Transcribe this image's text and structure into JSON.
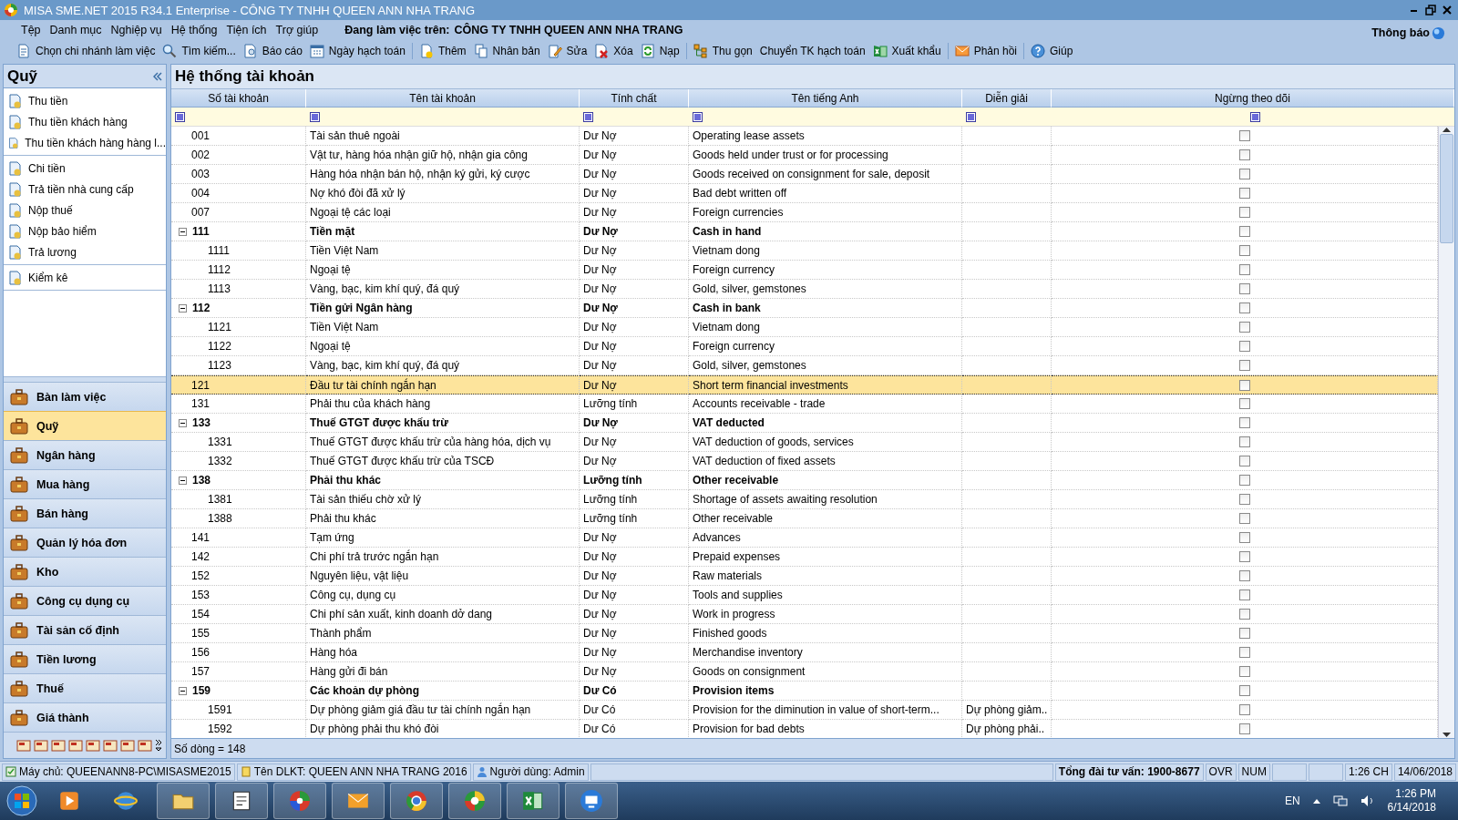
{
  "window": {
    "title": "MISA SME.NET 2015 R34.1 Enterprise - CÔNG TY TNHH QUEEN ANN NHA TRANG"
  },
  "menu": [
    "Tệp",
    "Danh mục",
    "Nghiệp vụ",
    "Hệ thống",
    "Tiện ích",
    "Trợ giúp"
  ],
  "working_on": {
    "label": "Đang làm việc trên:",
    "company": "CÔNG TY TNHH QUEEN ANN NHA TRANG"
  },
  "notifications": "Thông báo",
  "toolbar": [
    {
      "label": "Chọn chi nhánh làm việc",
      "kind": "doc",
      "separator_before": false
    },
    {
      "label": "Tìm kiếm...",
      "kind": "search",
      "separator_before": false
    },
    {
      "label": "Báo cáo",
      "kind": "report",
      "separator_before": false
    },
    {
      "label": "Ngày hạch toán",
      "kind": "calendar",
      "separator_before": false
    },
    {
      "label": "Thêm",
      "kind": "add",
      "separator_before": true
    },
    {
      "label": "Nhân bản",
      "kind": "copy",
      "separator_before": false
    },
    {
      "label": "Sửa",
      "kind": "edit",
      "separator_before": false
    },
    {
      "label": "Xóa",
      "kind": "delete",
      "separator_before": false
    },
    {
      "label": "Nạp",
      "kind": "reload",
      "separator_before": false
    },
    {
      "label": "Thu gọn",
      "kind": "tree",
      "separator_before": true
    },
    {
      "label": "Chuyển TK hạch toán",
      "kind": "none",
      "separator_before": false
    },
    {
      "label": "Xuất khẩu",
      "kind": "excel",
      "separator_before": false
    },
    {
      "label": "Phản hồi",
      "kind": "mail",
      "separator_before": true
    },
    {
      "label": "Giúp",
      "kind": "help",
      "separator_before": true
    }
  ],
  "sidebar": {
    "title": "Quỹ",
    "groups": [
      {
        "items": [
          "Thu tiền",
          "Thu tiền khách hàng",
          "Thu tiền khách hàng hàng l..."
        ]
      },
      {
        "items": [
          "Chi tiền",
          "Trả tiền nhà cung cấp",
          "Nộp thuế",
          "Nộp bảo hiểm",
          "Trả lương"
        ]
      },
      {
        "items": [
          "Kiểm kê"
        ]
      }
    ],
    "modules": [
      {
        "label": "Bàn làm việc",
        "selected": false
      },
      {
        "label": "Quỹ",
        "selected": true
      },
      {
        "label": "Ngân hàng",
        "selected": false
      },
      {
        "label": "Mua hàng",
        "selected": false
      },
      {
        "label": "Bán hàng",
        "selected": false
      },
      {
        "label": "Quản lý hóa đơn",
        "selected": false
      },
      {
        "label": "Kho",
        "selected": false
      },
      {
        "label": "Công cụ dụng cụ",
        "selected": false
      },
      {
        "label": "Tài sản cố định",
        "selected": false
      },
      {
        "label": "Tiền lương",
        "selected": false
      },
      {
        "label": "Thuế",
        "selected": false
      },
      {
        "label": "Giá thành",
        "selected": false
      }
    ]
  },
  "grid": {
    "title": "Hệ thống tài khoản",
    "columns": [
      "Số tài khoản",
      "Tên tài khoản",
      "Tính chất",
      "Tên tiếng Anh",
      "Diễn giải",
      "Ngừng theo dõi"
    ],
    "rows": [
      {
        "account": "001",
        "name": "Tài sản thuê ngoài",
        "nature": "Dư Nợ",
        "english": "Operating lease assets",
        "selected": false,
        "stopped": false
      },
      {
        "account": "002",
        "name": "Vật tư, hàng hóa nhận giữ hộ, nhận gia công",
        "nature": "Dư Nợ",
        "english": "Goods held under trust or for processing",
        "selected": false,
        "stopped": false
      },
      {
        "account": "003",
        "name": "Hàng hóa nhận bán hộ, nhận ký gửi, ký cược",
        "nature": "Dư Nợ",
        "english": "Goods received on consignment for sale, deposit",
        "selected": false,
        "stopped": false
      },
      {
        "account": "004",
        "name": "Nợ khó đòi đã xử lý",
        "nature": "Dư Nợ",
        "english": "Bad debt written off",
        "selected": false,
        "stopped": false
      },
      {
        "account": "007",
        "name": "Ngoại tệ các loại",
        "nature": "Dư Nợ",
        "english": "Foreign currencies",
        "selected": false,
        "stopped": false
      },
      {
        "account": "111",
        "name": "Tiền mặt",
        "nature": "Dư Nợ",
        "english": "Cash in hand",
        "selected": false,
        "stopped": false,
        "expanded": true,
        "children": [
          {
            "account": "1111",
            "name": "Tiền Việt Nam",
            "nature": "Dư Nợ",
            "english": "Vietnam dong",
            "selected": false,
            "stopped": false
          },
          {
            "account": "1112",
            "name": "Ngoại tệ",
            "nature": "Dư Nợ",
            "english": "Foreign currency",
            "selected": false,
            "stopped": false
          },
          {
            "account": "1113",
            "name": "Vàng, bạc, kim khí quý, đá quý",
            "nature": "Dư Nợ",
            "english": "Gold, silver, gemstones",
            "selected": false,
            "stopped": false
          }
        ]
      },
      {
        "account": "112",
        "name": "Tiền gửi Ngân hàng",
        "nature": "Dư Nợ",
        "english": "Cash in bank",
        "selected": false,
        "stopped": false,
        "expanded": true,
        "children": [
          {
            "account": "1121",
            "name": "Tiền Việt Nam",
            "nature": "Dư Nợ",
            "english": "Vietnam dong",
            "selected": false,
            "stopped": false
          },
          {
            "account": "1122",
            "name": "Ngoại tệ",
            "nature": "Dư Nợ",
            "english": "Foreign currency",
            "selected": false,
            "stopped": false
          },
          {
            "account": "1123",
            "name": "Vàng, bạc, kim khí quý, đá quý",
            "nature": "Dư Nợ",
            "english": "Gold, silver, gemstones",
            "selected": false,
            "stopped": false
          }
        ]
      },
      {
        "account": "121",
        "name": "Đầu tư tài chính ngắn hạn",
        "nature": "Dư Nợ",
        "english": "Short term financial investments",
        "selected": true,
        "stopped": false
      },
      {
        "account": "131",
        "name": "Phải thu của khách hàng",
        "nature": "Lưỡng tính",
        "english": "Accounts receivable - trade",
        "selected": false,
        "stopped": false
      },
      {
        "account": "133",
        "name": "Thuế GTGT được khấu trừ",
        "nature": "Dư Nợ",
        "english": "VAT deducted",
        "selected": false,
        "stopped": false,
        "expanded": true,
        "children": [
          {
            "account": "1331",
            "name": "Thuế GTGT được khấu trừ của hàng hóa, dịch vụ",
            "nature": "Dư Nợ",
            "english": "VAT deduction of goods, services",
            "selected": false,
            "stopped": false
          },
          {
            "account": "1332",
            "name": "Thuế GTGT được khấu trừ của TSCĐ",
            "nature": "Dư Nợ",
            "english": "VAT deduction of fixed assets",
            "selected": false,
            "stopped": false
          }
        ]
      },
      {
        "account": "138",
        "name": "Phải thu khác",
        "nature": "Lưỡng tính",
        "english": "Other receivable",
        "selected": false,
        "stopped": false,
        "expanded": true,
        "children": [
          {
            "account": "1381",
            "name": "Tài sản thiếu chờ xử lý",
            "nature": "Lưỡng tính",
            "english": "Shortage of assets awaiting resolution",
            "selected": false,
            "stopped": false
          },
          {
            "account": "1388",
            "name": "Phải thu khác",
            "nature": "Lưỡng tính",
            "english": "Other receivable",
            "selected": false,
            "stopped": false
          }
        ]
      },
      {
        "account": "141",
        "name": "Tạm ứng",
        "nature": "Dư Nợ",
        "english": "Advances",
        "selected": false,
        "stopped": false
      },
      {
        "account": "142",
        "name": "Chi phí trả trước ngắn hạn",
        "nature": "Dư Nợ",
        "english": "Prepaid expenses",
        "selected": false,
        "stopped": false
      },
      {
        "account": "152",
        "name": "Nguyên liệu, vật liệu",
        "nature": "Dư Nợ",
        "english": "Raw materials",
        "selected": false,
        "stopped": false
      },
      {
        "account": "153",
        "name": "Công cụ, dụng cụ",
        "nature": "Dư Nợ",
        "english": "Tools and supplies",
        "selected": false,
        "stopped": false
      },
      {
        "account": "154",
        "name": "Chi phí sản xuất, kinh doanh dở dang",
        "nature": "Dư Nợ",
        "english": "Work in progress",
        "selected": false,
        "stopped": false
      },
      {
        "account": "155",
        "name": "Thành phẩm",
        "nature": "Dư Nợ",
        "english": "Finished goods",
        "selected": false,
        "stopped": false
      },
      {
        "account": "156",
        "name": "Hàng hóa",
        "nature": "Dư Nợ",
        "english": "Merchandise inventory",
        "selected": false,
        "stopped": false
      },
      {
        "account": "157",
        "name": "Hàng gửi đi bán",
        "nature": "Dư Nợ",
        "english": "Goods on consignment",
        "selected": false,
        "stopped": false
      },
      {
        "account": "159",
        "name": "Các khoản dự phòng",
        "nature": "Dư Có",
        "english": "Provision items",
        "selected": false,
        "stopped": false,
        "expanded": true,
        "children": [
          {
            "account": "1591",
            "name": "Dự phòng giảm giá đầu tư tài chính ngắn hạn",
            "nature": "Dư Có",
            "english": "Provision for the diminution in value of short-term...",
            "description": "Dự phòng giảm..",
            "selected": false,
            "stopped": false
          },
          {
            "account": "1592",
            "name": "Dự phòng phải thu khó đòi",
            "nature": "Dư Có",
            "english": "Provision for bad debts",
            "description": "Dự phòng phải..",
            "selected": false,
            "stopped": false
          }
        ]
      }
    ],
    "row_count": "Số dòng = 148"
  },
  "status_bar": [
    {
      "text": "Máy chủ: QUEENANN8-PC\\MISASME2015",
      "kind": "server"
    },
    {
      "text": "Tên DLKT: QUEEN ANN NHA TRANG 2016",
      "kind": "database"
    },
    {
      "text": "Người dùng: Admin",
      "kind": "user"
    },
    {
      "text": "Tổng đài tư vấn: 1900-8677",
      "kind": "hotline"
    },
    {
      "text": "OVR",
      "kind": "plain"
    },
    {
      "text": "NUM",
      "kind": "plain"
    },
    {
      "text": "1:26 CH",
      "kind": "plain"
    },
    {
      "text": "14/06/2018",
      "kind": "plain"
    }
  ],
  "taskbar": {
    "language": "EN",
    "time": "1:26 PM",
    "date": "6/14/2018"
  }
}
